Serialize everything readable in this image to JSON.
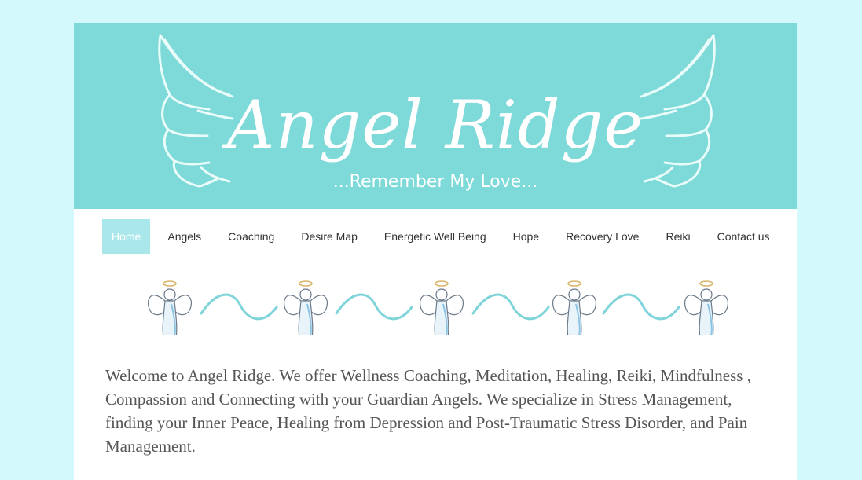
{
  "header": {
    "title": "Angel Ridge",
    "tagline": "...Remember My Love..."
  },
  "nav": {
    "items": [
      {
        "label": "Home",
        "active": true
      },
      {
        "label": "Angels"
      },
      {
        "label": "Coaching"
      },
      {
        "label": "Desire Map"
      },
      {
        "label": "Energetic Well Being"
      },
      {
        "label": "Hope"
      },
      {
        "label": "Recovery Love"
      },
      {
        "label": "Reiki"
      },
      {
        "label": "Contact us"
      }
    ]
  },
  "main": {
    "intro": "Welcome to Angel Ridge.  We offer Wellness Coaching, Meditation,  Healing, Reiki, Mindfulness , Compassion and Connecting with your Guardian Angels.  We specialize in Stress Management, finding your Inner Peace, Healing from Depression and Post-Traumatic Stress Disorder, and  Pain Management."
  },
  "colors": {
    "background": "#d4f9fc",
    "banner": "#7ed9d9",
    "nav_active": "#a9e7ea",
    "wave": "#7ed4d8",
    "text": "#555555"
  },
  "icons": [
    "wings-icon",
    "angel-icon",
    "wave-divider"
  ]
}
